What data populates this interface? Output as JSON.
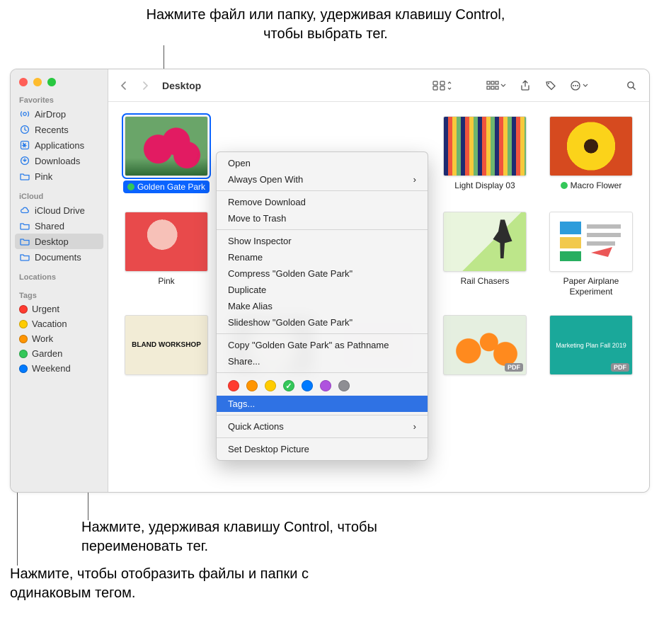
{
  "callouts": {
    "top": "Нажмите файл или папку, удерживая клавишу Control, чтобы выбрать тег.",
    "mid": "Нажмите, удерживая клавишу Control, чтобы переименовать тег.",
    "bot": "Нажмите, чтобы отобразить файлы и папки с одинаковым тегом."
  },
  "toolbar": {
    "title": "Desktop"
  },
  "sidebar": {
    "favorites_heading": "Favorites",
    "favorites": [
      {
        "label": "AirDrop"
      },
      {
        "label": "Recents"
      },
      {
        "label": "Applications"
      },
      {
        "label": "Downloads"
      },
      {
        "label": "Pink"
      }
    ],
    "icloud_heading": "iCloud",
    "icloud": [
      {
        "label": "iCloud Drive"
      },
      {
        "label": "Shared"
      },
      {
        "label": "Desktop"
      },
      {
        "label": "Documents"
      }
    ],
    "locations_heading": "Locations",
    "tags_heading": "Tags",
    "tags": [
      {
        "label": "Urgent",
        "color": "#ff3b30"
      },
      {
        "label": "Vacation",
        "color": "#ffcc00"
      },
      {
        "label": "Work",
        "color": "#ff9500"
      },
      {
        "label": "Garden",
        "color": "#34c759"
      },
      {
        "label": "Weekend",
        "color": "#007aff"
      }
    ]
  },
  "files": [
    {
      "name": "Golden Gate Park",
      "tag_color": "#34c759",
      "selected": true
    },
    {
      "name": ""
    },
    {
      "name": ""
    },
    {
      "name": "Light Display 03"
    },
    {
      "name": "Macro Flower",
      "tag_color": "#34c759"
    },
    {
      "name": "Pink"
    },
    {
      "name": ""
    },
    {
      "name": ""
    },
    {
      "name": "Rail Chasers"
    },
    {
      "name": "Paper Airplane Experiment"
    },
    {
      "name": ""
    },
    {
      "name": ""
    },
    {
      "name": ""
    },
    {
      "name": ""
    },
    {
      "name": ""
    }
  ],
  "bland_text": "BLAND WORKSHOP",
  "marketing_text": "Marketing Plan Fall 2019",
  "pdf_badge": "PDF",
  "context_menu": {
    "open": "Open",
    "always_open_with": "Always Open With",
    "remove_download": "Remove Download",
    "move_to_trash": "Move to Trash",
    "show_inspector": "Show Inspector",
    "rename": "Rename",
    "compress": "Compress \"Golden Gate Park\"",
    "duplicate": "Duplicate",
    "make_alias": "Make Alias",
    "slideshow": "Slideshow \"Golden Gate Park\"",
    "copy_pathname": "Copy \"Golden Gate Park\" as Pathname",
    "share": "Share...",
    "tags": "Tags...",
    "quick_actions": "Quick Actions",
    "set_desktop": "Set Desktop Picture",
    "colors": [
      {
        "c": "#ff3b30"
      },
      {
        "c": "#ff9500"
      },
      {
        "c": "#ffcc00"
      },
      {
        "c": "#34c759",
        "checked": true
      },
      {
        "c": "#007aff"
      },
      {
        "c": "#af52de"
      },
      {
        "c": "#8e8e93"
      }
    ]
  }
}
